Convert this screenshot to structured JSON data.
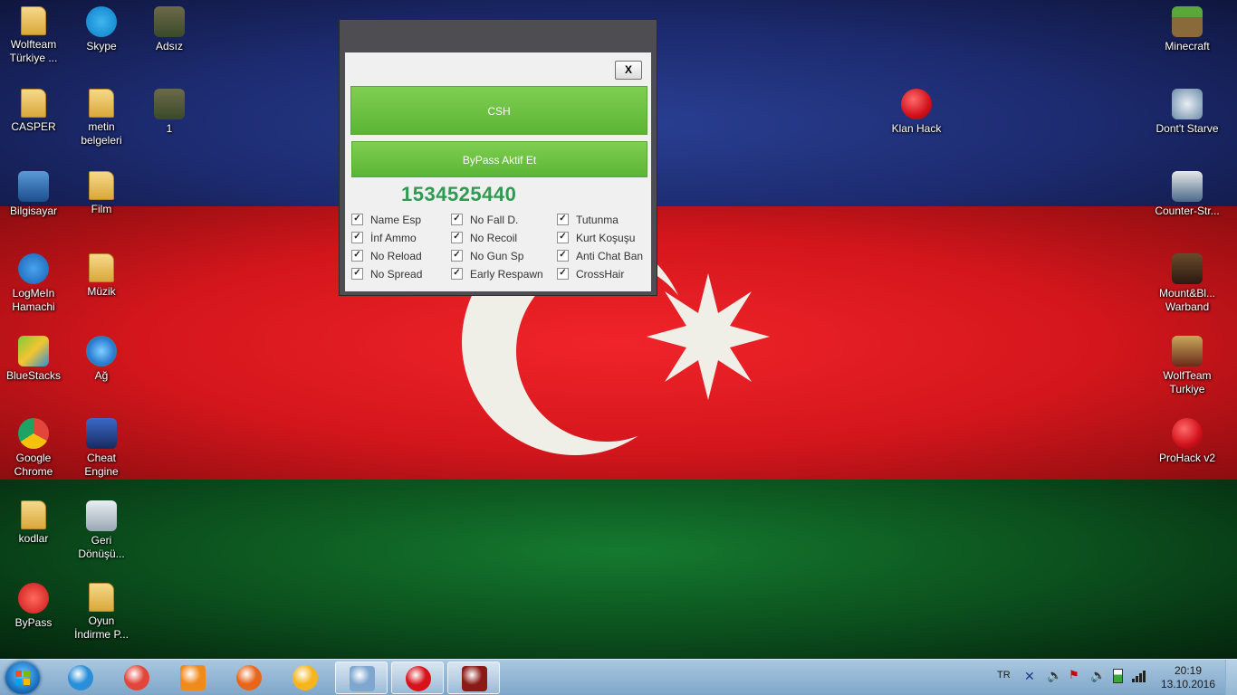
{
  "desktop_left": [
    {
      "label": "Wolfteam Türkiye ...",
      "icon": "folder-icon",
      "col": 0,
      "row": 0
    },
    {
      "label": "Skype",
      "icon": "skype-icon",
      "col": 1,
      "row": 0
    },
    {
      "label": "Adsız",
      "icon": "image-icon",
      "col": 2,
      "row": 0
    },
    {
      "label": "CASPER",
      "icon": "user-folder-icon",
      "col": 0,
      "row": 1
    },
    {
      "label": "metin belgeleri",
      "icon": "folder-icon",
      "col": 1,
      "row": 1
    },
    {
      "label": "1",
      "icon": "image-icon",
      "col": 2,
      "row": 1
    },
    {
      "label": "Bilgisayar",
      "icon": "computer-icon",
      "col": 0,
      "row": 2
    },
    {
      "label": "Film",
      "icon": "folder-icon",
      "col": 1,
      "row": 2
    },
    {
      "label": "LogMeIn Hamachi",
      "icon": "hamachi-icon",
      "col": 0,
      "row": 3
    },
    {
      "label": "Müzik",
      "icon": "folder-icon",
      "col": 1,
      "row": 3
    },
    {
      "label": "BlueStacks",
      "icon": "bluestacks-icon",
      "col": 0,
      "row": 4
    },
    {
      "label": "Ağ",
      "icon": "network-icon",
      "col": 1,
      "row": 4
    },
    {
      "label": "Google Chrome",
      "icon": "chrome-icon",
      "col": 0,
      "row": 5
    },
    {
      "label": "Cheat Engine",
      "icon": "cheat-engine-icon",
      "col": 1,
      "row": 5
    },
    {
      "label": "kodlar",
      "icon": "folder-icon",
      "col": 0,
      "row": 6
    },
    {
      "label": "Geri Dönüşü...",
      "icon": "recycle-bin-icon",
      "col": 1,
      "row": 6
    },
    {
      "label": "ByPass",
      "icon": "bypass-icon",
      "col": 0,
      "row": 7
    },
    {
      "label": "Oyun İndirme P...",
      "icon": "folder-icon",
      "col": 1,
      "row": 7
    }
  ],
  "desktop_right": [
    {
      "label": "Minecraft",
      "icon": "minecraft-icon",
      "row": 0
    },
    {
      "label": "Dont't Starve",
      "icon": "dont-starve-icon",
      "row": 1
    },
    {
      "label": "Counter-Str...",
      "icon": "counter-strike-icon",
      "row": 2
    },
    {
      "label": "Mount&Bl... Warband",
      "icon": "warband-icon",
      "row": 3
    },
    {
      "label": "WolfTeam Turkiye",
      "icon": "wolfteam-icon",
      "row": 4
    },
    {
      "label": "ProHack v2",
      "icon": "prohack-icon",
      "row": 5
    }
  ],
  "desktop_extra": {
    "label": "Klan Hack",
    "icon": "klan-hack-icon"
  },
  "dialog": {
    "close_label": "X",
    "btn_csh": "CSH",
    "btn_bypass": "ByPass Aktif Et",
    "counter": "1534525440",
    "options": [
      {
        "label": "Name Esp",
        "checked": true
      },
      {
        "label": "İnf Ammo",
        "checked": true
      },
      {
        "label": "No Reload",
        "checked": true
      },
      {
        "label": "No Spread",
        "checked": true
      },
      {
        "label": "No Fall D.",
        "checked": true
      },
      {
        "label": "No Recoil",
        "checked": true
      },
      {
        "label": "No Gun Sp",
        "checked": true
      },
      {
        "label": "Early Respawn",
        "checked": true
      },
      {
        "label": "Tutunma",
        "checked": true
      },
      {
        "label": "Kurt Koşuşu",
        "checked": true
      },
      {
        "label": "Anti Chat Ban",
        "checked": true
      },
      {
        "label": "CrossHair",
        "checked": true
      }
    ]
  },
  "taskbar": {
    "pinned": [
      {
        "name": "ie-icon",
        "color": "#2a8fd8",
        "active": false
      },
      {
        "name": "chrome-icon",
        "color": "#e2463a",
        "active": false
      },
      {
        "name": "media-player-icon",
        "color": "#f08a1c",
        "active": false
      },
      {
        "name": "firefox-icon",
        "color": "#e8661c",
        "active": false
      },
      {
        "name": "game-launcher-icon",
        "color": "#f6b51d",
        "active": false
      },
      {
        "name": "paint-icon",
        "color": "#7ea6cf",
        "active": true
      },
      {
        "name": "turkish-flag-app-icon",
        "color": "#d8121b",
        "active": true
      },
      {
        "name": "wolfteam-app-icon",
        "color": "#8a1a16",
        "active": true
      }
    ],
    "lang": "TR",
    "time": "20:19",
    "date": "13.10.2016"
  },
  "colors": {
    "flag_blue": "#1c2a6e",
    "flag_red": "#d4161c",
    "flag_green": "#0b4f1d",
    "btn_green": "#6cc244",
    "counter_green": "#2e9a52"
  }
}
